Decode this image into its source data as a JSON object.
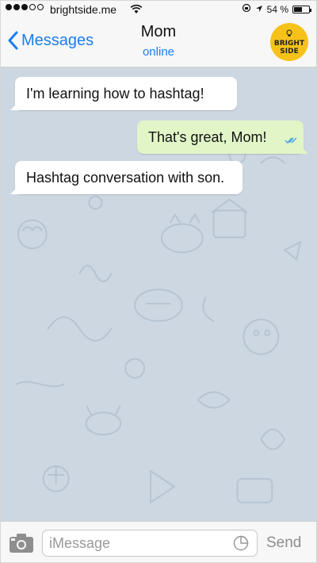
{
  "status_bar": {
    "carrier": "brightside.me",
    "battery": "54 %",
    "battery_level": 0.54,
    "icons": [
      "signal-icon",
      "wifi-icon",
      "location-icon",
      "lock-rotation-icon",
      "battery-icon"
    ]
  },
  "nav": {
    "back_label": "Messages",
    "contact_name": "Mom",
    "contact_status": "online",
    "logo_text": [
      "BRIGHT",
      "SIDE"
    ]
  },
  "messages": [
    {
      "direction": "incoming",
      "text": "I'm learning how to hashtag!"
    },
    {
      "direction": "outgoing",
      "text": "That's great, Mom!",
      "read": true
    },
    {
      "direction": "incoming",
      "text": "Hashtag conversation with son."
    }
  ],
  "input": {
    "placeholder": "iMessage",
    "value": "",
    "send_label": "Send"
  },
  "colors": {
    "accent": "#1a7ef0",
    "chat_background": "#cdd7e1",
    "incoming_bubble": "#ffffff",
    "outgoing_bubble": "#e1f5c6",
    "logo": "#f6c21a"
  }
}
